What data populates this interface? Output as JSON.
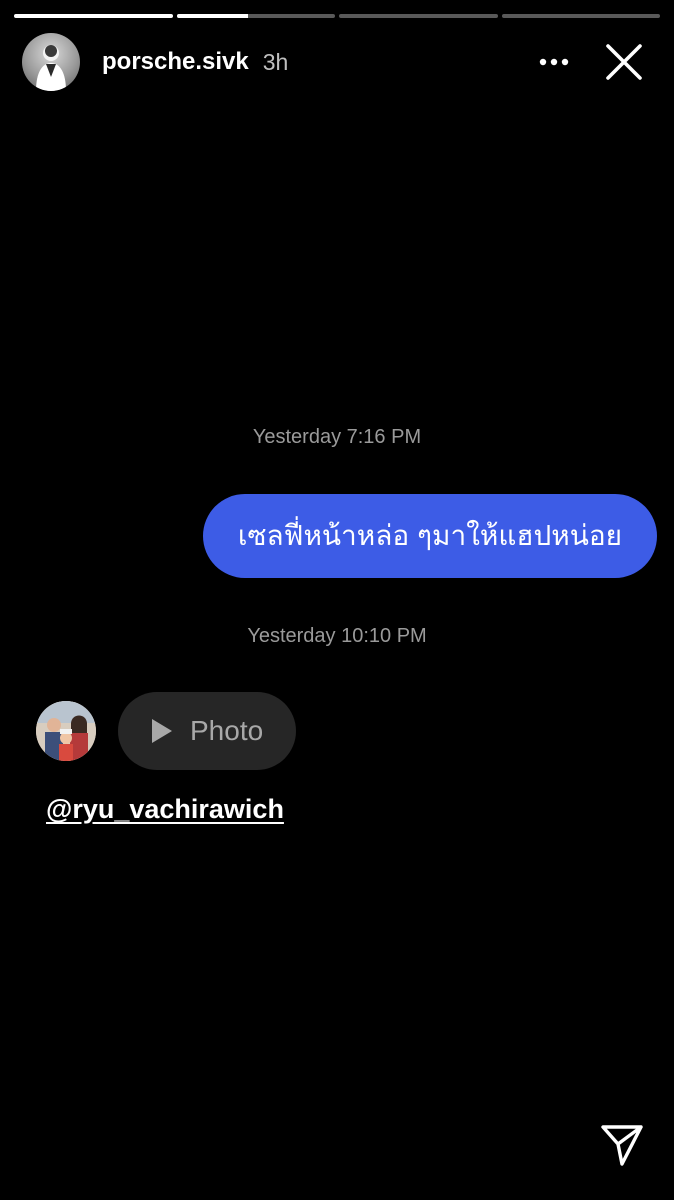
{
  "story": {
    "segments": [
      {
        "progress": 1.0
      },
      {
        "progress": 0.45
      },
      {
        "progress": 0.0
      },
      {
        "progress": 0.0
      }
    ],
    "username": "porsche.sivk",
    "time_ago": "3h",
    "more_icon": "more-horizontal-icon",
    "close_icon": "close-icon",
    "share_icon": "send-icon"
  },
  "conversation": {
    "timestamp_1": "Yesterday 7:16 PM",
    "sent_message": "เซลฟี่หน้าหล่อ ๆมาให้แฮปหน่อย",
    "timestamp_2": "Yesterday 10:10 PM",
    "received_media_label": "Photo",
    "received_media_icon": "play-icon"
  },
  "mention": "@ryu_vachirawich",
  "colors": {
    "sent_bubble": "#3d5ce6",
    "received_pill": "#262626",
    "background": "#000000"
  }
}
